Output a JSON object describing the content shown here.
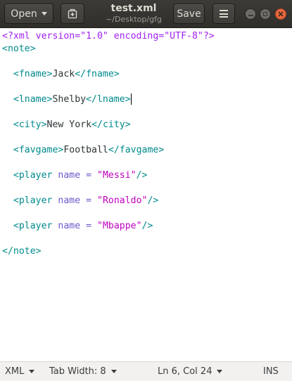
{
  "window": {
    "title": "test.xml",
    "subtitle": "~/Desktop/gfg"
  },
  "headerbar": {
    "open_label": "Open",
    "save_label": "Save"
  },
  "editor": {
    "lines": [
      [
        {
          "t": "<?xml version=\"1.0\" encoding=\"UTF-8\"?>",
          "c": "decl"
        }
      ],
      [
        {
          "t": "<note>",
          "c": "tag"
        }
      ],
      [],
      [
        {
          "t": "  <fname>",
          "c": "tag"
        },
        {
          "t": "Jack",
          "c": "text"
        },
        {
          "t": "</fname>",
          "c": "tag"
        }
      ],
      [],
      [
        {
          "t": "  <lname>",
          "c": "tag"
        },
        {
          "t": "Shelby",
          "c": "text"
        },
        {
          "t": "</lname>",
          "c": "tag"
        }
      ],
      [],
      [
        {
          "t": "  <city>",
          "c": "tag"
        },
        {
          "t": "New York",
          "c": "text"
        },
        {
          "t": "</city>",
          "c": "tag"
        }
      ],
      [],
      [
        {
          "t": "  <favgame>",
          "c": "tag"
        },
        {
          "t": "Football",
          "c": "text"
        },
        {
          "t": "</favgame>",
          "c": "tag"
        }
      ],
      [],
      [
        {
          "t": "  <player",
          "c": "tag"
        },
        {
          "t": " name = ",
          "c": "attr"
        },
        {
          "t": "\"Messi\"",
          "c": "str"
        },
        {
          "t": "/>",
          "c": "tag"
        }
      ],
      [],
      [
        {
          "t": "  <player",
          "c": "tag"
        },
        {
          "t": " name = ",
          "c": "attr"
        },
        {
          "t": "\"Ronaldo\"",
          "c": "str"
        },
        {
          "t": "/>",
          "c": "tag"
        }
      ],
      [],
      [
        {
          "t": "  <player",
          "c": "tag"
        },
        {
          "t": " name = ",
          "c": "attr"
        },
        {
          "t": "\"Mbappe\"",
          "c": "str"
        },
        {
          "t": "/>",
          "c": "tag"
        }
      ],
      [],
      [
        {
          "t": "</note>",
          "c": "tag"
        }
      ]
    ],
    "cursor_line": 6,
    "colors": {
      "decl": "#a020f0",
      "tag": "#008a8c",
      "attr": "#6a5acd",
      "str": "#c000c0",
      "text": "#2e3436"
    }
  },
  "statusbar": {
    "language": "XML",
    "tab_width": "Tab Width: 8",
    "position": "Ln 6, Col 24",
    "mode": "INS"
  }
}
